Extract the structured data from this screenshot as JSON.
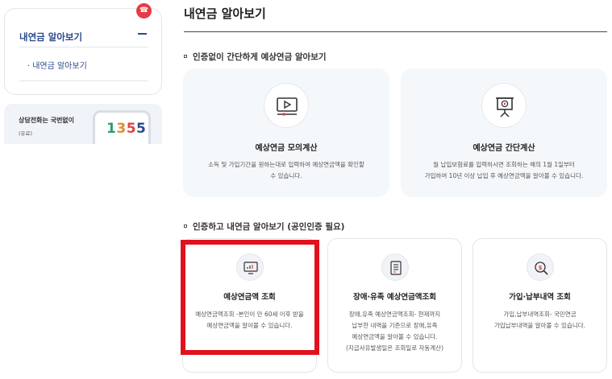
{
  "sidebar": {
    "menu_title": "내연금 알아보기",
    "sub_item": "내연금 알아보기",
    "sub_bullet": "·"
  },
  "call": {
    "text": "상담전화는 국번없이",
    "sub": "(유료)",
    "number_parts": [
      "1",
      "3",
      "5",
      "5"
    ]
  },
  "main": {
    "title": "내연금 알아보기",
    "section1_title": "인증없이 간단하게 예상연금 알아보기",
    "section2_title": "인증하고 내연금 알아보기 (공인인증 필요)",
    "cards_no_auth": [
      {
        "title": "예상연금 모의계산",
        "desc_lines": [
          "소득 및 가입기간을 원하는대로 입력하여 예상연금액을 확인할",
          "수 있습니다."
        ],
        "icon": "monitor-play-icon"
      },
      {
        "title": "예상연금 간단계산",
        "desc_lines": [
          "월 납입보험료를 입력하시면 조회하는 해의 1월 1일부터",
          "가입하여 10년 이상 납입 후 예상연금액을 알아볼 수 있습니다."
        ],
        "icon": "presentation-board-icon"
      }
    ],
    "cards_auth": [
      {
        "title": "예상연금액 조회",
        "desc_lines": [
          "예상연금액조회 -본인이 만 60세 이후 받을",
          "예상연금액을 알아볼 수 있습니다."
        ],
        "icon": "screen-chart-icon"
      },
      {
        "title": "장애·유족 예상연금액조회",
        "desc_lines": [
          "장애,유족 예상연금액조회- 현재까지",
          "납부한 내역을 기준으로 장애,유족",
          "예상연금액을 알아볼 수 있습니다.",
          "(지급사유발생일은 조회일로 자동계산)"
        ],
        "icon": "document-list-icon"
      },
      {
        "title": "가입·납부내역 조회",
        "desc_lines": [
          "가입,납부내역조회- 국민연금",
          "가입납부내역을 알아볼 수 있습니다."
        ],
        "icon": "money-search-icon"
      }
    ]
  },
  "colors": {
    "accent": "#2c4a8d",
    "highlight": "#e1111d",
    "card_bg": "#f5f8fb"
  }
}
